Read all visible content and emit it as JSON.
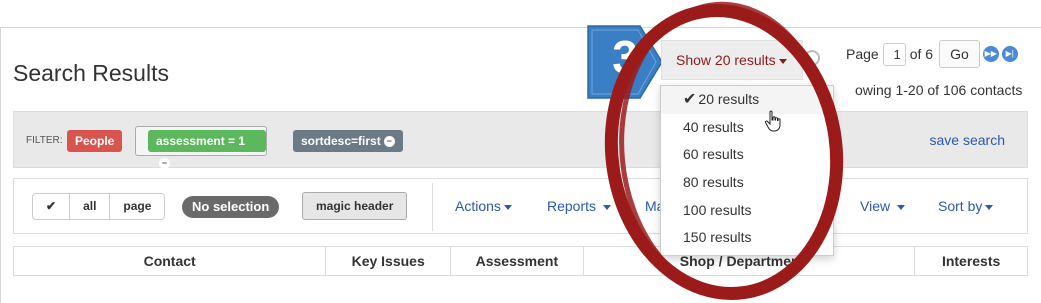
{
  "page": {
    "title": "Search Results"
  },
  "pager": {
    "page_label": "Page",
    "page_value": "1",
    "of_label": "of 6",
    "go_label": "Go",
    "showing_text": "owing 1-20 of 106 contacts"
  },
  "show_results": {
    "label": "Show 20 results"
  },
  "step_badge": {
    "number": "3",
    "color": "#3a7ec4"
  },
  "filter": {
    "label": "FILTER:",
    "tags": [
      {
        "label": "People",
        "color": "#d9534f"
      },
      {
        "label": "assessment = 1",
        "color": "#5cb85c",
        "removable": true
      },
      {
        "label": "sortdesc=first",
        "color": "#6c7a86",
        "removable": true
      }
    ],
    "save_label": "save search"
  },
  "selection": {
    "check_icon": "check-icon",
    "all_label": "all",
    "page_label": "page",
    "no_selection": "No selection",
    "magic_header": "magic header"
  },
  "menus": {
    "actions": "Actions",
    "reports": "Reports",
    "ma": "Ma",
    "view": "View",
    "sort_by": "Sort by"
  },
  "table": {
    "columns": [
      "Contact",
      "Key Issues",
      "Assessment",
      "Shop / Department",
      "Interests"
    ]
  },
  "dropdown": {
    "options": [
      "20 results",
      "40 results",
      "60 results",
      "80 results",
      "100 results",
      "150 results"
    ],
    "selected": "20 results"
  },
  "colors": {
    "ring": "#9b1b1b",
    "link": "#2a5aa8"
  }
}
